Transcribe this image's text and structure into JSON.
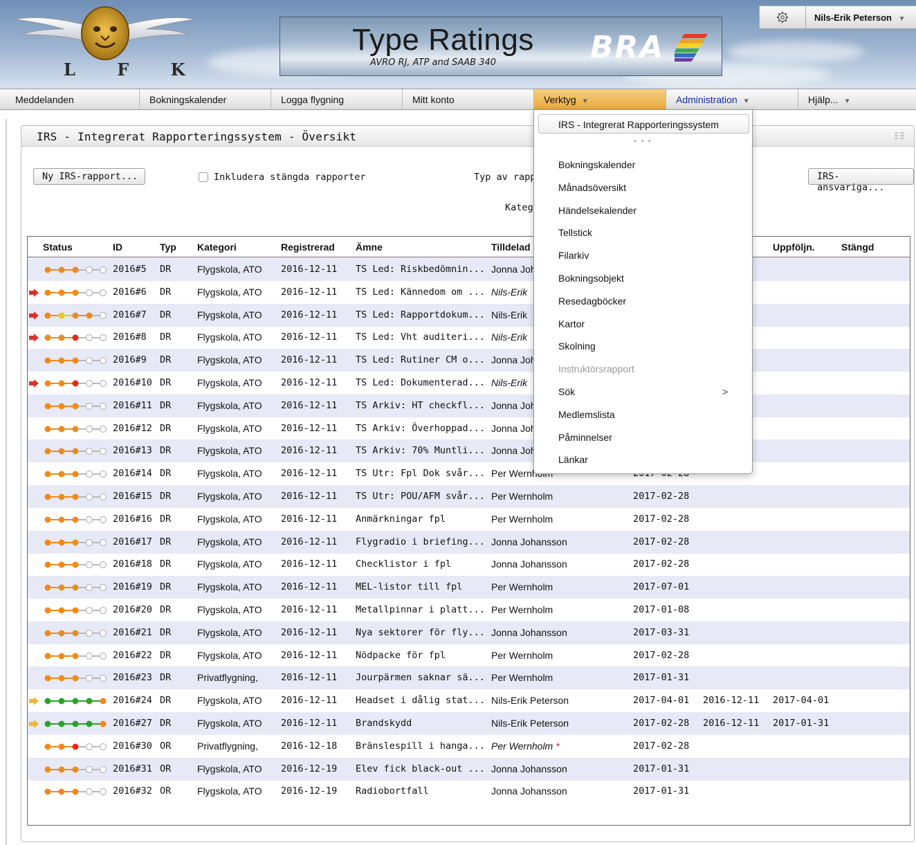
{
  "header": {
    "logo_letters": "L F K",
    "banner_title": "Type Ratings",
    "banner_subtitle": "AVRO RJ, ATP and SAAB 340",
    "banner_brand": "BRA",
    "user_name": "Nils-Erik Peterson",
    "user_caret": "▼",
    "settings_icon": "gear-icon"
  },
  "nav": {
    "items": [
      {
        "label": "Meddelanden"
      },
      {
        "label": "Bokningskalender"
      },
      {
        "label": "Logga flygning"
      },
      {
        "label": "Mitt konto"
      },
      {
        "label": "Verktyg",
        "caret": "▼"
      },
      {
        "label": "Administration",
        "caret": "▼"
      },
      {
        "label": "Hjälp...",
        "caret": "▼"
      }
    ]
  },
  "panel": {
    "title": "IRS - Integrerat Rapporteringssystem - Översikt",
    "new_button": "Ny IRS-rapport...",
    "include_closed_label": "Inkludera stängda rapporter",
    "include_closed_checked": false,
    "type_label": "Typ av rappo",
    "category_label": "Kateg",
    "responsible_button": "IRS-ansvariga..."
  },
  "table": {
    "headers": {
      "status": "Status",
      "id": "ID",
      "typ": "Typ",
      "kategori": "Kategori",
      "registrerad": "Registrerad",
      "amne": "Ämne",
      "tilldelad": "Tilldelad",
      "uppfoljn": "Uppföljn.",
      "stangd": "Stängd"
    },
    "rows": [
      {
        "arrow": "",
        "dots": [
          "o",
          "o",
          "o",
          "e",
          "e"
        ],
        "id": "2016#5",
        "typ": "DR",
        "kategori": "Flygskola, ATO",
        "registrerad": "2016-12-11",
        "amne": "TS Led: Riskbedömnin...",
        "tilldelad": "Jonna Joh",
        "italic": false,
        "star": "",
        "deadline": "",
        "started": "",
        "uppfoljn": "",
        "stangd": ""
      },
      {
        "arrow": "red",
        "dots": [
          "o",
          "o",
          "o",
          "e",
          "e"
        ],
        "id": "2016#6",
        "typ": "DR",
        "kategori": "Flygskola, ATO",
        "registrerad": "2016-12-11",
        "amne": "TS Led: Kännedom om ...",
        "tilldelad": "Nils-Erik",
        "italic": true,
        "star": "",
        "deadline": "",
        "started": "",
        "uppfoljn": "",
        "stangd": ""
      },
      {
        "arrow": "red",
        "dots": [
          "o",
          "y",
          "o",
          "o",
          "e"
        ],
        "id": "2016#7",
        "typ": "DR",
        "kategori": "Flygskola, ATO",
        "registrerad": "2016-12-11",
        "amne": "TS Led: Rapportdokum...",
        "tilldelad": "Nils-Erik",
        "italic": false,
        "star": "",
        "deadline": "",
        "started": "1",
        "uppfoljn": "",
        "stangd": ""
      },
      {
        "arrow": "red",
        "dots": [
          "o",
          "o",
          "r",
          "e",
          "e"
        ],
        "id": "2016#8",
        "typ": "DR",
        "kategori": "Flygskola, ATO",
        "registrerad": "2016-12-11",
        "amne": "TS Led: Vht auditeri...",
        "tilldelad": "Nils-Erik",
        "italic": true,
        "star": "",
        "deadline": "",
        "started": "",
        "uppfoljn": "",
        "stangd": ""
      },
      {
        "arrow": "",
        "dots": [
          "o",
          "o",
          "o",
          "e",
          "e"
        ],
        "id": "2016#9",
        "typ": "DR",
        "kategori": "Flygskola, ATO",
        "registrerad": "2016-12-11",
        "amne": "TS Led: Rutiner CM o...",
        "tilldelad": "Jonna Joh",
        "italic": false,
        "star": "",
        "deadline": "",
        "started": "",
        "uppfoljn": "",
        "stangd": ""
      },
      {
        "arrow": "red",
        "dots": [
          "o",
          "o",
          "r",
          "e",
          "e"
        ],
        "id": "2016#10",
        "typ": "DR",
        "kategori": "Flygskola, ATO",
        "registrerad": "2016-12-11",
        "amne": "TS Led: Dokumenterad...",
        "tilldelad": "Nils-Erik",
        "italic": true,
        "star": "",
        "deadline": "",
        "started": "",
        "uppfoljn": "",
        "stangd": ""
      },
      {
        "arrow": "",
        "dots": [
          "o",
          "o",
          "o",
          "e",
          "e"
        ],
        "id": "2016#11",
        "typ": "DR",
        "kategori": "Flygskola, ATO",
        "registrerad": "2016-12-11",
        "amne": "TS Arkiv: HT checkfl...",
        "tilldelad": "Jonna Joh",
        "italic": false,
        "star": "",
        "deadline": "",
        "started": "",
        "uppfoljn": "",
        "stangd": ""
      },
      {
        "arrow": "",
        "dots": [
          "o",
          "o",
          "o",
          "e",
          "e"
        ],
        "id": "2016#12",
        "typ": "DR",
        "kategori": "Flygskola, ATO",
        "registrerad": "2016-12-11",
        "amne": "TS Arkiv: Överhoppad...",
        "tilldelad": "Jonna Joh",
        "italic": false,
        "star": "",
        "deadline": "",
        "started": "",
        "uppfoljn": "",
        "stangd": ""
      },
      {
        "arrow": "",
        "dots": [
          "o",
          "o",
          "o",
          "e",
          "e"
        ],
        "id": "2016#13",
        "typ": "DR",
        "kategori": "Flygskola, ATO",
        "registrerad": "2016-12-11",
        "amne": "TS Arkiv: 70% Muntli...",
        "tilldelad": "Jonna Joh",
        "italic": false,
        "star": "",
        "deadline": "",
        "started": "",
        "uppfoljn": "",
        "stangd": ""
      },
      {
        "arrow": "",
        "dots": [
          "o",
          "o",
          "o",
          "e",
          "e"
        ],
        "id": "2016#14",
        "typ": "DR",
        "kategori": "Flygskola, ATO",
        "registrerad": "2016-12-11",
        "amne": "TS Utr: Fpl Dok svår...",
        "tilldelad": "Per Wernholm",
        "italic": false,
        "star": "",
        "deadline": "2017-02-28",
        "started": "",
        "uppfoljn": "",
        "stangd": ""
      },
      {
        "arrow": "",
        "dots": [
          "o",
          "o",
          "o",
          "e",
          "e"
        ],
        "id": "2016#15",
        "typ": "DR",
        "kategori": "Flygskola, ATO",
        "registrerad": "2016-12-11",
        "amne": "TS Utr: POU/AFM svår...",
        "tilldelad": "Per Wernholm",
        "italic": false,
        "star": "",
        "deadline": "2017-02-28",
        "started": "",
        "uppfoljn": "",
        "stangd": ""
      },
      {
        "arrow": "",
        "dots": [
          "o",
          "o",
          "o",
          "e",
          "e"
        ],
        "id": "2016#16",
        "typ": "DR",
        "kategori": "Flygskola, ATO",
        "registrerad": "2016-12-11",
        "amne": "Anmärkningar fpl",
        "tilldelad": "Per Wernholm",
        "italic": false,
        "star": "",
        "deadline": "2017-02-28",
        "started": "",
        "uppfoljn": "",
        "stangd": ""
      },
      {
        "arrow": "",
        "dots": [
          "o",
          "o",
          "o",
          "e",
          "e"
        ],
        "id": "2016#17",
        "typ": "DR",
        "kategori": "Flygskola, ATO",
        "registrerad": "2016-12-11",
        "amne": "Flygradio i briefing...",
        "tilldelad": "Jonna Johansson",
        "italic": false,
        "star": "",
        "deadline": "2017-02-28",
        "started": "",
        "uppfoljn": "",
        "stangd": ""
      },
      {
        "arrow": "",
        "dots": [
          "o",
          "o",
          "o",
          "e",
          "e"
        ],
        "id": "2016#18",
        "typ": "DR",
        "kategori": "Flygskola, ATO",
        "registrerad": "2016-12-11",
        "amne": "Checklistor i fpl",
        "tilldelad": "Jonna Johansson",
        "italic": false,
        "star": "",
        "deadline": "2017-02-28",
        "started": "",
        "uppfoljn": "",
        "stangd": ""
      },
      {
        "arrow": "",
        "dots": [
          "o",
          "o",
          "o",
          "e",
          "e"
        ],
        "id": "2016#19",
        "typ": "DR",
        "kategori": "Flygskola, ATO",
        "registrerad": "2016-12-11",
        "amne": "MEL-listor till fpl",
        "tilldelad": "Per Wernholm",
        "italic": false,
        "star": "",
        "deadline": "2017-07-01",
        "started": "",
        "uppfoljn": "",
        "stangd": ""
      },
      {
        "arrow": "",
        "dots": [
          "o",
          "o",
          "o",
          "e",
          "e"
        ],
        "id": "2016#20",
        "typ": "DR",
        "kategori": "Flygskola, ATO",
        "registrerad": "2016-12-11",
        "amne": "Metallpinnar i platt...",
        "tilldelad": "Per Wernholm",
        "italic": false,
        "star": "",
        "deadline": "2017-01-08",
        "started": "",
        "uppfoljn": "",
        "stangd": ""
      },
      {
        "arrow": "",
        "dots": [
          "o",
          "o",
          "o",
          "e",
          "e"
        ],
        "id": "2016#21",
        "typ": "DR",
        "kategori": "Flygskola, ATO",
        "registrerad": "2016-12-11",
        "amne": "Nya sektorer för fly...",
        "tilldelad": "Jonna Johansson",
        "italic": false,
        "star": "",
        "deadline": "2017-03-31",
        "started": "",
        "uppfoljn": "",
        "stangd": ""
      },
      {
        "arrow": "",
        "dots": [
          "o",
          "o",
          "o",
          "e",
          "e"
        ],
        "id": "2016#22",
        "typ": "DR",
        "kategori": "Flygskola, ATO",
        "registrerad": "2016-12-11",
        "amne": "Nödpacke för fpl",
        "tilldelad": "Per Wernholm",
        "italic": false,
        "star": "",
        "deadline": "2017-02-28",
        "started": "",
        "uppfoljn": "",
        "stangd": ""
      },
      {
        "arrow": "",
        "dots": [
          "o",
          "o",
          "o",
          "e",
          "e"
        ],
        "id": "2016#23",
        "typ": "DR",
        "kategori": "Privatflygning,",
        "registrerad": "2016-12-11",
        "amne": "Jourpärmen saknar sä...",
        "tilldelad": "Per Wernholm",
        "italic": false,
        "star": "",
        "deadline": "2017-01-31",
        "started": "",
        "uppfoljn": "",
        "stangd": ""
      },
      {
        "arrow": "yellow",
        "dots": [
          "g",
          "g",
          "g",
          "g",
          "o"
        ],
        "id": "2016#24",
        "typ": "DR",
        "kategori": "Flygskola, ATO",
        "registrerad": "2016-12-11",
        "amne": "Headset i dålig stat...",
        "tilldelad": "Nils-Erik Peterson",
        "italic": false,
        "star": "",
        "deadline": "2017-04-01",
        "started": "2016-12-11",
        "uppfoljn": "2017-04-01",
        "stangd": ""
      },
      {
        "arrow": "yellow",
        "dots": [
          "g",
          "g",
          "g",
          "g",
          "o"
        ],
        "id": "2016#27",
        "typ": "DR",
        "kategori": "Flygskola, ATO",
        "registrerad": "2016-12-11",
        "amne": "Brandskydd",
        "tilldelad": "Nils-Erik Peterson",
        "italic": false,
        "star": "",
        "deadline": "2017-02-28",
        "started": "2016-12-11",
        "uppfoljn": "2017-01-31",
        "stangd": ""
      },
      {
        "arrow": "",
        "dots": [
          "o",
          "o",
          "r",
          "e",
          "e"
        ],
        "id": "2016#30",
        "typ": "OR",
        "kategori": "Privatflygning,",
        "registrerad": "2016-12-18",
        "amne": "Bränslespill i hanga...",
        "tilldelad": "Per Wernholm",
        "italic": true,
        "star": "*",
        "deadline": "2017-02-28",
        "started": "",
        "uppfoljn": "",
        "stangd": ""
      },
      {
        "arrow": "",
        "dots": [
          "o",
          "o",
          "o",
          "e",
          "e"
        ],
        "id": "2016#31",
        "typ": "OR",
        "kategori": "Flygskola, ATO",
        "registrerad": "2016-12-19",
        "amne": "Elev fick black-out ...",
        "tilldelad": "Jonna Johansson",
        "italic": false,
        "star": "",
        "deadline": "2017-01-31",
        "started": "",
        "uppfoljn": "",
        "stangd": ""
      },
      {
        "arrow": "",
        "dots": [
          "o",
          "o",
          "o",
          "e",
          "e"
        ],
        "id": "2016#32",
        "typ": "OR",
        "kategori": "Flygskola, ATO",
        "registrerad": "2016-12-19",
        "amne": "Radiobortfall",
        "tilldelad": "Jonna Johansson",
        "italic": false,
        "star": "",
        "deadline": "2017-01-31",
        "started": "",
        "uppfoljn": "",
        "stangd": ""
      }
    ]
  },
  "dropdown": {
    "first": "IRS - Integrerat Rapporteringssystem",
    "separator": "• • •",
    "items": [
      {
        "label": "Bokningskalender",
        "disabled": false,
        "submenu": ""
      },
      {
        "label": "Månadsöversikt",
        "disabled": false,
        "submenu": ""
      },
      {
        "label": "Händelsekalender",
        "disabled": false,
        "submenu": ""
      },
      {
        "label": "Tellstick",
        "disabled": false,
        "submenu": ""
      },
      {
        "label": "Filarkiv",
        "disabled": false,
        "submenu": ""
      },
      {
        "label": "Bokningsobjekt",
        "disabled": false,
        "submenu": ""
      },
      {
        "label": "Resedagböcker",
        "disabled": false,
        "submenu": ""
      },
      {
        "label": "Kartor",
        "disabled": false,
        "submenu": ""
      },
      {
        "label": "Skolning",
        "disabled": false,
        "submenu": ""
      },
      {
        "label": "Instruktörsrapport",
        "disabled": true,
        "submenu": ""
      },
      {
        "label": "Sök",
        "disabled": false,
        "submenu": ">"
      },
      {
        "label": "Medlemslista",
        "disabled": false,
        "submenu": ""
      },
      {
        "label": "Påminnelser",
        "disabled": false,
        "submenu": ""
      },
      {
        "label": "Länkar",
        "disabled": false,
        "submenu": ""
      }
    ]
  },
  "colors": {
    "dot_orange": "#f08a1c",
    "dot_yellow": "#f5c518",
    "dot_red": "#e02a18",
    "dot_green": "#29a329",
    "arrow_red": "#d9322a",
    "arrow_yellow": "#e8b83c",
    "row_shade": "#e7e9f6",
    "active_menu": "#eeb44f"
  }
}
